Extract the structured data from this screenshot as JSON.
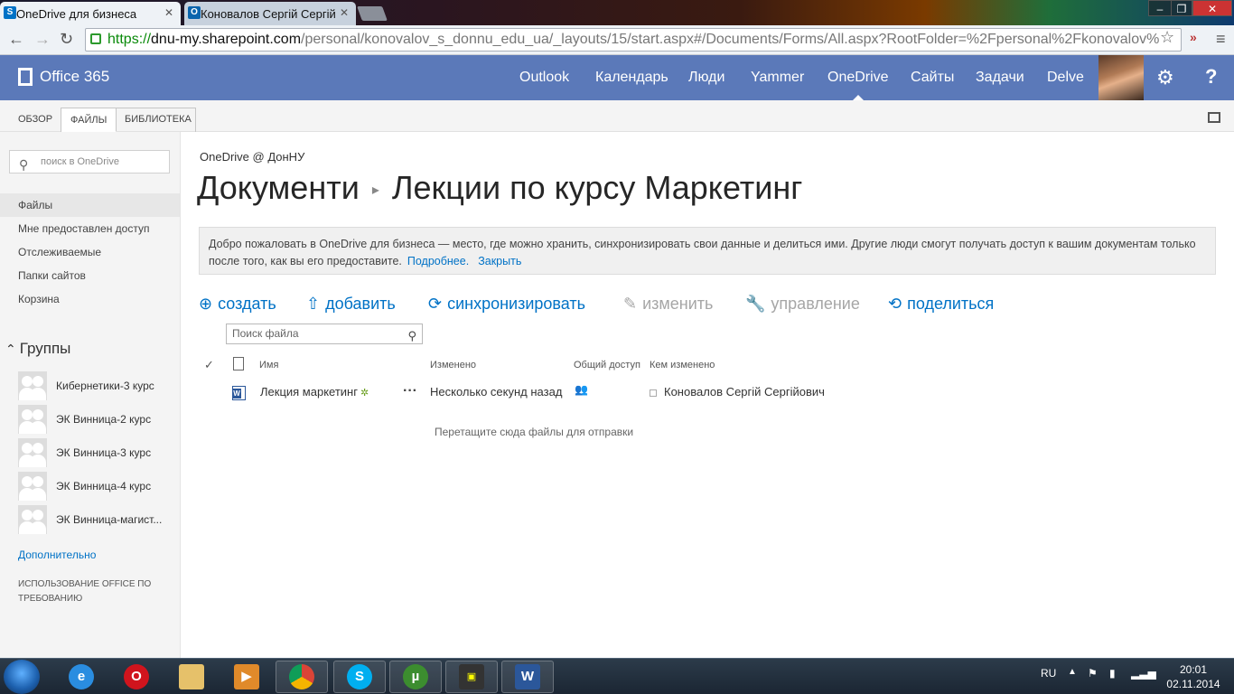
{
  "browser": {
    "tabs": [
      {
        "title": "OneDrive для бизнеса",
        "icon": "sharepoint-favicon"
      },
      {
        "title": "Коновалов Сергій Сергій",
        "icon": "outlook-favicon"
      }
    ],
    "url_scheme": "https://",
    "url_host": "dnu-my.sharepoint.com",
    "url_path": "/personal/konovalov_s_donnu_edu_ua/_layouts/15/start.aspx#/Documents/Forms/All.aspx?RootFolder=%2Fpersonal%2Fkonovalov%"
  },
  "suitebar": {
    "brand": "Office 365",
    "nav": [
      "Outlook",
      "Календарь",
      "Люди",
      "Yammer",
      "OneDrive",
      "Сайты",
      "Задачи",
      "Delve"
    ],
    "active": "OneDrive",
    "color": "#5b79b9"
  },
  "ribbon": {
    "tabs": [
      "ОБЗОР",
      "ФАЙЛЫ",
      "БИБЛИОТЕКА"
    ],
    "active": "ФАЙЛЫ"
  },
  "leftnav": {
    "search_placeholder": "поиск в OneDrive",
    "items": [
      "Файлы",
      "Мне предоставлен доступ",
      "Отслеживаемые",
      "Папки сайтов",
      "Корзина"
    ],
    "groups_heading": "Группы",
    "groups": [
      "Кибернетики-3 курс",
      "ЭК Винница-2 курс",
      "ЭК Винница-3 курс",
      "ЭК Винница-4 курс",
      "ЭК Винница-магист..."
    ],
    "more": "Дополнительно",
    "office_on_demand": "ИСПОЛЬЗОВАНИЕ OFFICE ПО ТРЕБОВАНИЮ"
  },
  "main": {
    "site": "OneDrive @ ДонНУ",
    "title_root": "Документи",
    "title_folder": "Лекции по курсу Маркетинг",
    "notice_text": "Добро пожаловать в OneDrive для бизнеса — место, где можно хранить, синхронизировать свои данные и делиться ими. Другие люди смогут получать доступ к вашим документам только после того, как вы его предоставите.",
    "notice_more": "Подробнее.",
    "notice_close": "Закрыть",
    "commands": [
      "создать",
      "добавить",
      "синхронизировать",
      "изменить",
      "управление",
      "поделиться"
    ],
    "file_search_placeholder": "Поиск файла",
    "columns": [
      "Имя",
      "Изменено",
      "Общий доступ",
      "Кем изменено"
    ],
    "files": [
      {
        "name": "Лекция маркетинг",
        "modified": "Несколько секунд назад",
        "modified_by": "Коновалов Сергій Сергійович"
      }
    ],
    "dropzone": "Перетащите сюда файлы для отправки"
  },
  "taskbar": {
    "lang": "RU",
    "time": "20:01",
    "date": "02.11.2014"
  }
}
